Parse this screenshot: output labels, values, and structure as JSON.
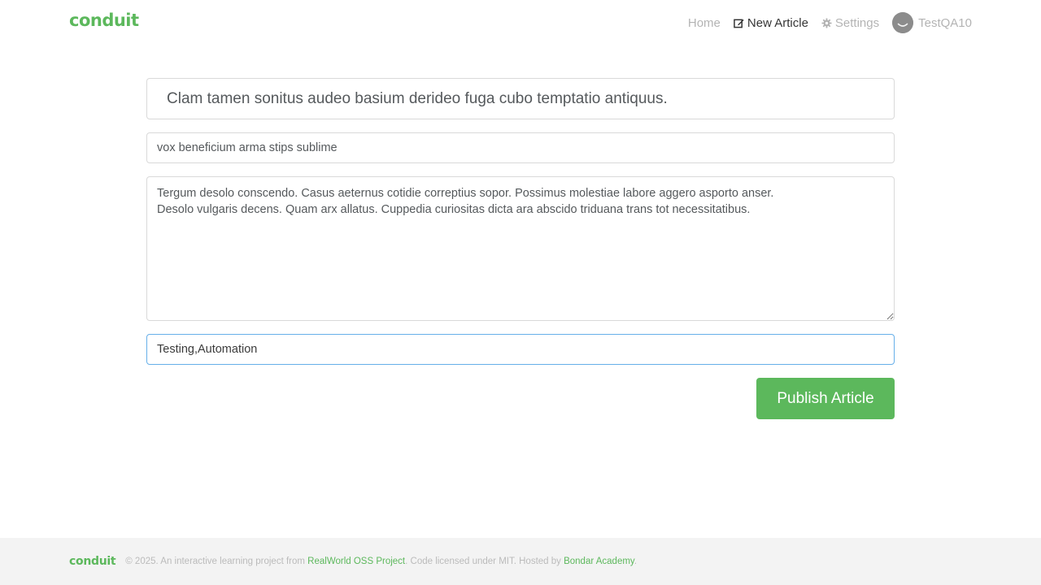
{
  "navbar": {
    "brand": "conduit",
    "items": [
      {
        "label": "Home",
        "icon": "none",
        "active": false
      },
      {
        "label": "New Article",
        "icon": "compose-icon",
        "active": true
      },
      {
        "label": "Settings",
        "icon": "gear-icon",
        "active": false
      },
      {
        "label": "TestQA10",
        "icon": "avatar",
        "active": false
      }
    ]
  },
  "editor": {
    "title_value": "Clam tamen sonitus audeo basium derideo fuga cubo temptatio antiquus.",
    "about_value": "vox beneficium arma stips sublime",
    "body_value": "Tergum desolo conscendo. Casus aeternus cotidie correptius sopor. Possimus molestiae labore aggero asporto anser.\nDesolo vulgaris decens. Quam arx allatus. Cuppedia curiositas dicta ara abscido triduana trans tot necessitatibus.",
    "tags_value": "Testing,Automation",
    "publish_label": "Publish Article"
  },
  "footer": {
    "logo": "conduit",
    "text_before": "© 2025. An interactive learning project from ",
    "link1": "RealWorld OSS Project",
    "text_middle": ". Code licensed under MIT. Hosted by ",
    "link2": "Bondar Academy",
    "text_after": "."
  },
  "colors": {
    "brand_green": "#5cb85c",
    "focus_border": "#66afe9",
    "footer_bg": "#f3f3f3"
  }
}
